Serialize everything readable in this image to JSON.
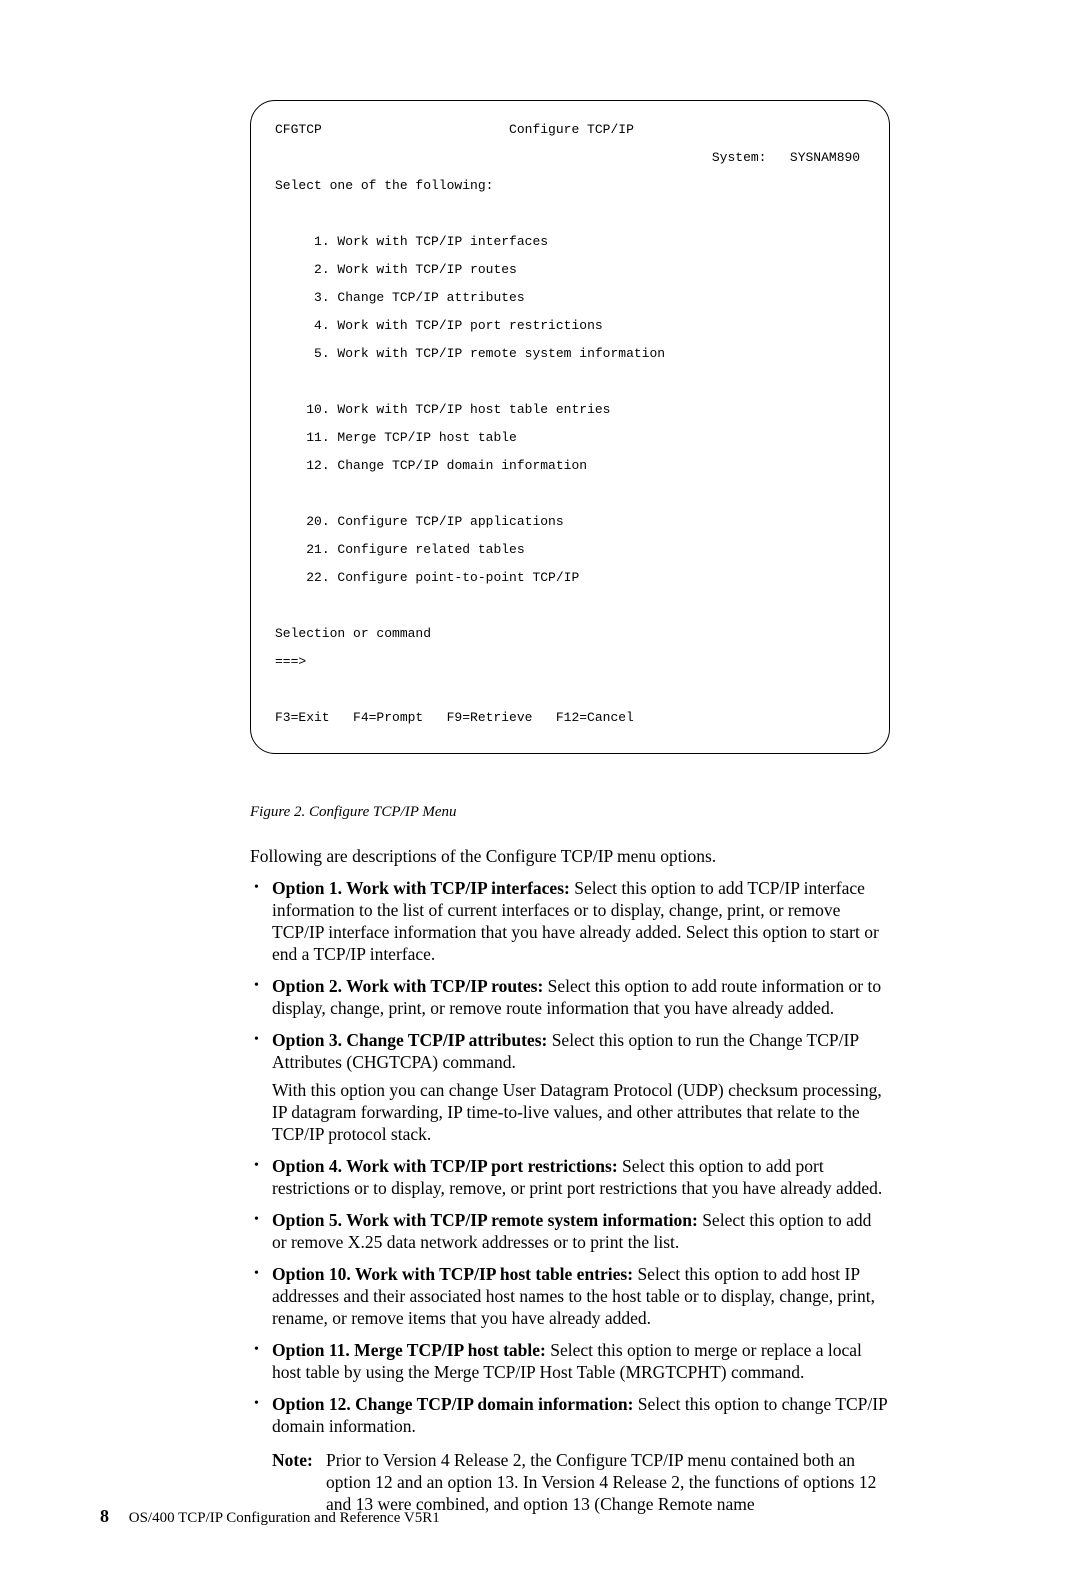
{
  "terminal": {
    "cmd": "CFGTCP",
    "title": "Configure TCP/IP",
    "system_label": "System:",
    "system_name": "SYSNAM890",
    "select_prompt": "Select one of the following:",
    "menu_group1": [
      " 1. Work with TCP/IP interfaces",
      " 2. Work with TCP/IP routes",
      " 3. Change TCP/IP attributes",
      " 4. Work with TCP/IP port restrictions",
      " 5. Work with TCP/IP remote system information"
    ],
    "menu_group2": [
      "10. Work with TCP/IP host table entries",
      "11. Merge TCP/IP host table",
      "12. Change TCP/IP domain information"
    ],
    "menu_group3": [
      "20. Configure TCP/IP applications",
      "21. Configure related tables",
      "22. Configure point-to-point TCP/IP"
    ],
    "selection_label": "Selection or command",
    "prompt_marker": "===>",
    "fkeys": "F3=Exit   F4=Prompt   F9=Retrieve   F12=Cancel"
  },
  "figure_caption": "Figure 2. Configure TCP/IP Menu",
  "intro": "Following are descriptions of the Configure TCP/IP menu options.",
  "options": [
    {
      "title": "Option 1. Work with TCP/IP interfaces:",
      "text": " Select this option to add TCP/IP interface information to the list of current interfaces or to display, change, print, or remove TCP/IP interface information that you have already added. Select this option to start or end a TCP/IP interface."
    },
    {
      "title": "Option 2. Work with TCP/IP routes:",
      "text": " Select this option to add route information or to display, change, print, or remove route information that you have already added."
    },
    {
      "title": "Option 3. Change TCP/IP attributes:",
      "text": " Select this option to run the Change TCP/IP Attributes (CHGTCPA) command.",
      "para2": "With this option you can change User Datagram Protocol (UDP) checksum processing, IP datagram forwarding, IP time-to-live values, and other attributes that relate to the TCP/IP protocol stack."
    },
    {
      "title": "Option 4. Work with TCP/IP port restrictions:",
      "text": " Select this option to add port restrictions or to display, remove, or print port restrictions that you have already added."
    },
    {
      "title": "Option 5. Work with TCP/IP remote system information:",
      "text": " Select this option to add or remove X.25 data network addresses or to print the list."
    },
    {
      "title": "Option 10. Work with TCP/IP host table entries:",
      "text": " Select this option to add host IP addresses and their associated host names to the host table or to display, change, print, rename, or remove items that you have already added."
    },
    {
      "title": "Option 11. Merge TCP/IP host table:",
      "text": " Select this option to merge or replace a local host table by using the Merge TCP/IP Host Table (MRGTCPHT) command."
    },
    {
      "title": "Option 12. Change TCP/IP domain information:",
      "text": " Select this option to change TCP/IP domain information.",
      "note_label": "Note:",
      "note_text": "Prior to Version 4 Release 2, the Configure TCP/IP menu contained both an option 12 and an option 13. In Version 4 Release 2, the functions of options 12 and 13 were combined, and option 13 (Change Remote name"
    }
  ],
  "footer": {
    "page": "8",
    "book": "OS/400 TCP/IP Configuration and Reference V5R1"
  }
}
